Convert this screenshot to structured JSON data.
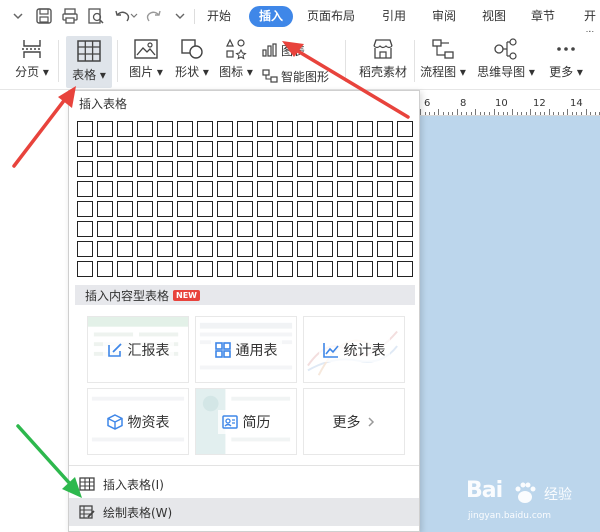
{
  "menu_tabs": [
    {
      "label": "开始"
    },
    {
      "label": "插入",
      "active": true
    },
    {
      "label": "页面布局"
    },
    {
      "label": "引用"
    },
    {
      "label": "审阅"
    },
    {
      "label": "视图"
    },
    {
      "label": "章节"
    },
    {
      "label": "开发"
    }
  ],
  "ribbon": {
    "page_break": "分页",
    "table": "表格",
    "picture": "图片",
    "shape": "形状",
    "icon": "图标",
    "chart": "图表",
    "smart_art": "智能图形",
    "materials": "稻壳素材",
    "flowchart": "流程图",
    "mindmap": "思维导图",
    "more": "更多"
  },
  "ruler": {
    "numbers": [
      "6",
      "8",
      "10",
      "12",
      "14"
    ]
  },
  "panel": {
    "title": "插入表格",
    "grid": {
      "cols": 17,
      "rows": 8
    },
    "content_tables_title": "插入内容型表格",
    "new_badge": "NEW",
    "tiles": {
      "report": "汇报表",
      "general": "通用表",
      "stats": "统计表",
      "material": "物资表",
      "resume": "简历",
      "more": "更多"
    },
    "insert_table": "插入表格(I)",
    "draw_table": "绘制表格(W)"
  },
  "watermark": {
    "brand": "Bai",
    "name": "经验",
    "url": "jingyan.baidu.com"
  },
  "colors": {
    "accent": "#3f87e8",
    "arrow_red": "#e8433c",
    "arrow_green": "#2db84d",
    "doc_blue": "#bcd6ec"
  }
}
